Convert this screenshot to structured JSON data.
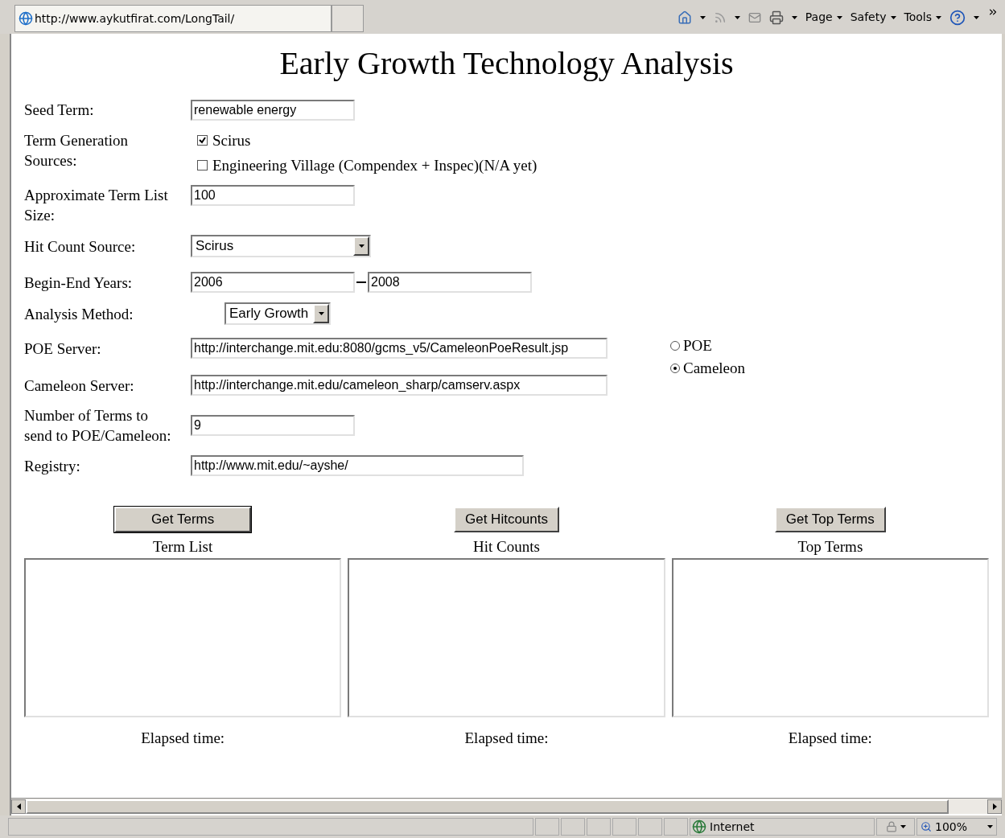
{
  "browser": {
    "address": "http://www.aykutfirat.com/LongTail/",
    "menus": [
      {
        "label": "Page"
      },
      {
        "label": "Safety"
      },
      {
        "label": "Tools"
      }
    ]
  },
  "title": "Early Growth Technology Analysis",
  "fields": [
    {
      "kind": "text",
      "label": "Seed Term:",
      "value": "renewable energy"
    },
    {
      "kind": "checks",
      "label": "Term Generation Sources:",
      "options": [
        {
          "label": "Scirus",
          "checked": true
        },
        {
          "label": "Engineering Village (Compendex + Inspec)(N/A yet)",
          "checked": false
        }
      ]
    },
    {
      "kind": "text",
      "label": "Approximate Term List Size:",
      "value": "100"
    },
    {
      "kind": "select",
      "label": "Hit Count Source:",
      "value": "Scirus"
    },
    {
      "kind": "range",
      "label": "Begin-End Years:",
      "from": "2006",
      "to": "2008"
    },
    {
      "kind": "select_small",
      "label": "Analysis Method:",
      "value": "Early Growth"
    }
  ],
  "servers": [
    {
      "label": "POE Server:",
      "value": "http://interchange.mit.edu:8080/gcms_v5/CameleonPoeResult.jsp"
    },
    {
      "label": "Cameleon Server:",
      "value": "http://interchange.mit.edu/cameleon_sharp/camserv.aspx"
    }
  ],
  "server_choice": [
    {
      "label": "POE",
      "selected": false
    },
    {
      "label": "Cameleon",
      "selected": true
    }
  ],
  "fields_after": [
    {
      "label": "Number of Terms to send to POE/Cameleon:",
      "value": "9"
    },
    {
      "label": "Registry:",
      "value": "http://www.mit.edu/~ayshe/"
    }
  ],
  "panels": [
    {
      "button": "Get Terms",
      "heading": "Term List",
      "footer": "Elapsed time:",
      "focused": true
    },
    {
      "button": "Get Hitcounts",
      "heading": "Hit Counts",
      "footer": "Elapsed time:",
      "focused": false
    },
    {
      "button": "Get Top Terms",
      "heading": "Top Terms",
      "footer": "Elapsed time:",
      "focused": false
    }
  ],
  "status_bar": {
    "zone": "Internet",
    "zoom": "100%"
  }
}
